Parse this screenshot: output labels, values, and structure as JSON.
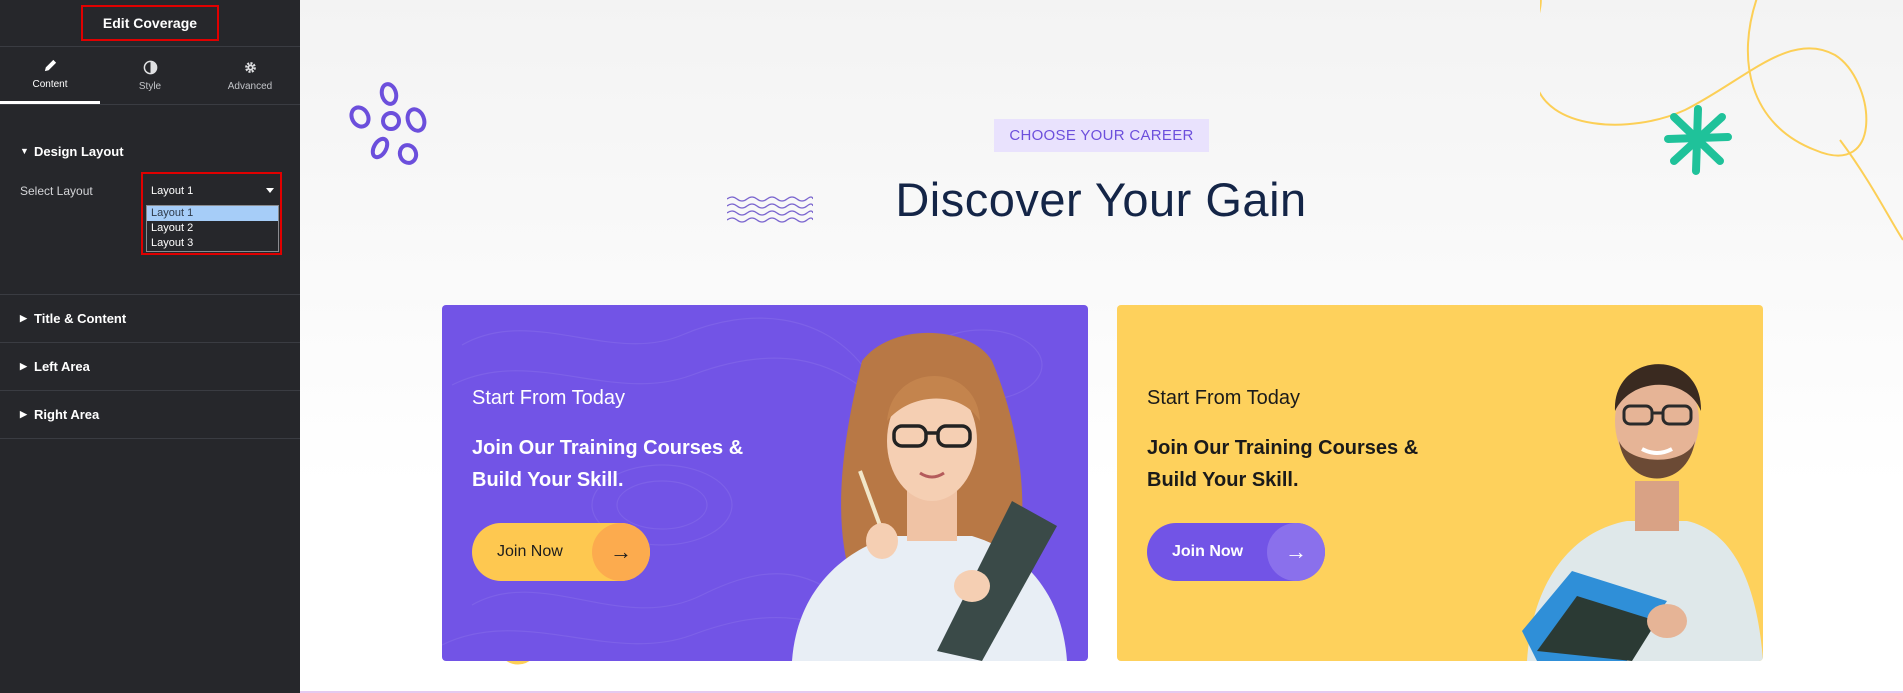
{
  "editor": {
    "title": "Edit Coverage",
    "tabs": [
      {
        "label": "Content",
        "icon": "pencil-icon"
      },
      {
        "label": "Style",
        "icon": "half-circle-icon"
      },
      {
        "label": "Advanced",
        "icon": "gear-icon"
      }
    ],
    "sections": {
      "design_layout": "Design Layout",
      "title_content": "Title & Content",
      "left_area": "Left Area",
      "right_area": "Right Area"
    },
    "select_label": "Select Layout",
    "select_value": "Layout 1",
    "options": [
      "Layout 1",
      "Layout 2",
      "Layout 3"
    ],
    "toggle": "‹"
  },
  "hero": {
    "eyebrow": "CHOOSE YOUR CAREER",
    "heading": "Discover Your Gain"
  },
  "cards": [
    {
      "subtitle": "Start From Today",
      "text": "Join Our Training Courses & Build Your Skill.",
      "button": "Join Now",
      "arrow": "→",
      "background": "#7254e6"
    },
    {
      "subtitle": "Start From Today",
      "text": "Join Our Training Courses & Build Your Skill.",
      "button": "Join Now",
      "arrow": "→",
      "background": "#fed15c"
    }
  ],
  "colors": {
    "accent_purple": "#7254e6",
    "accent_yellow": "#fed15c",
    "teal_star": "#1fc29a",
    "highlight_red": "#e00000"
  }
}
